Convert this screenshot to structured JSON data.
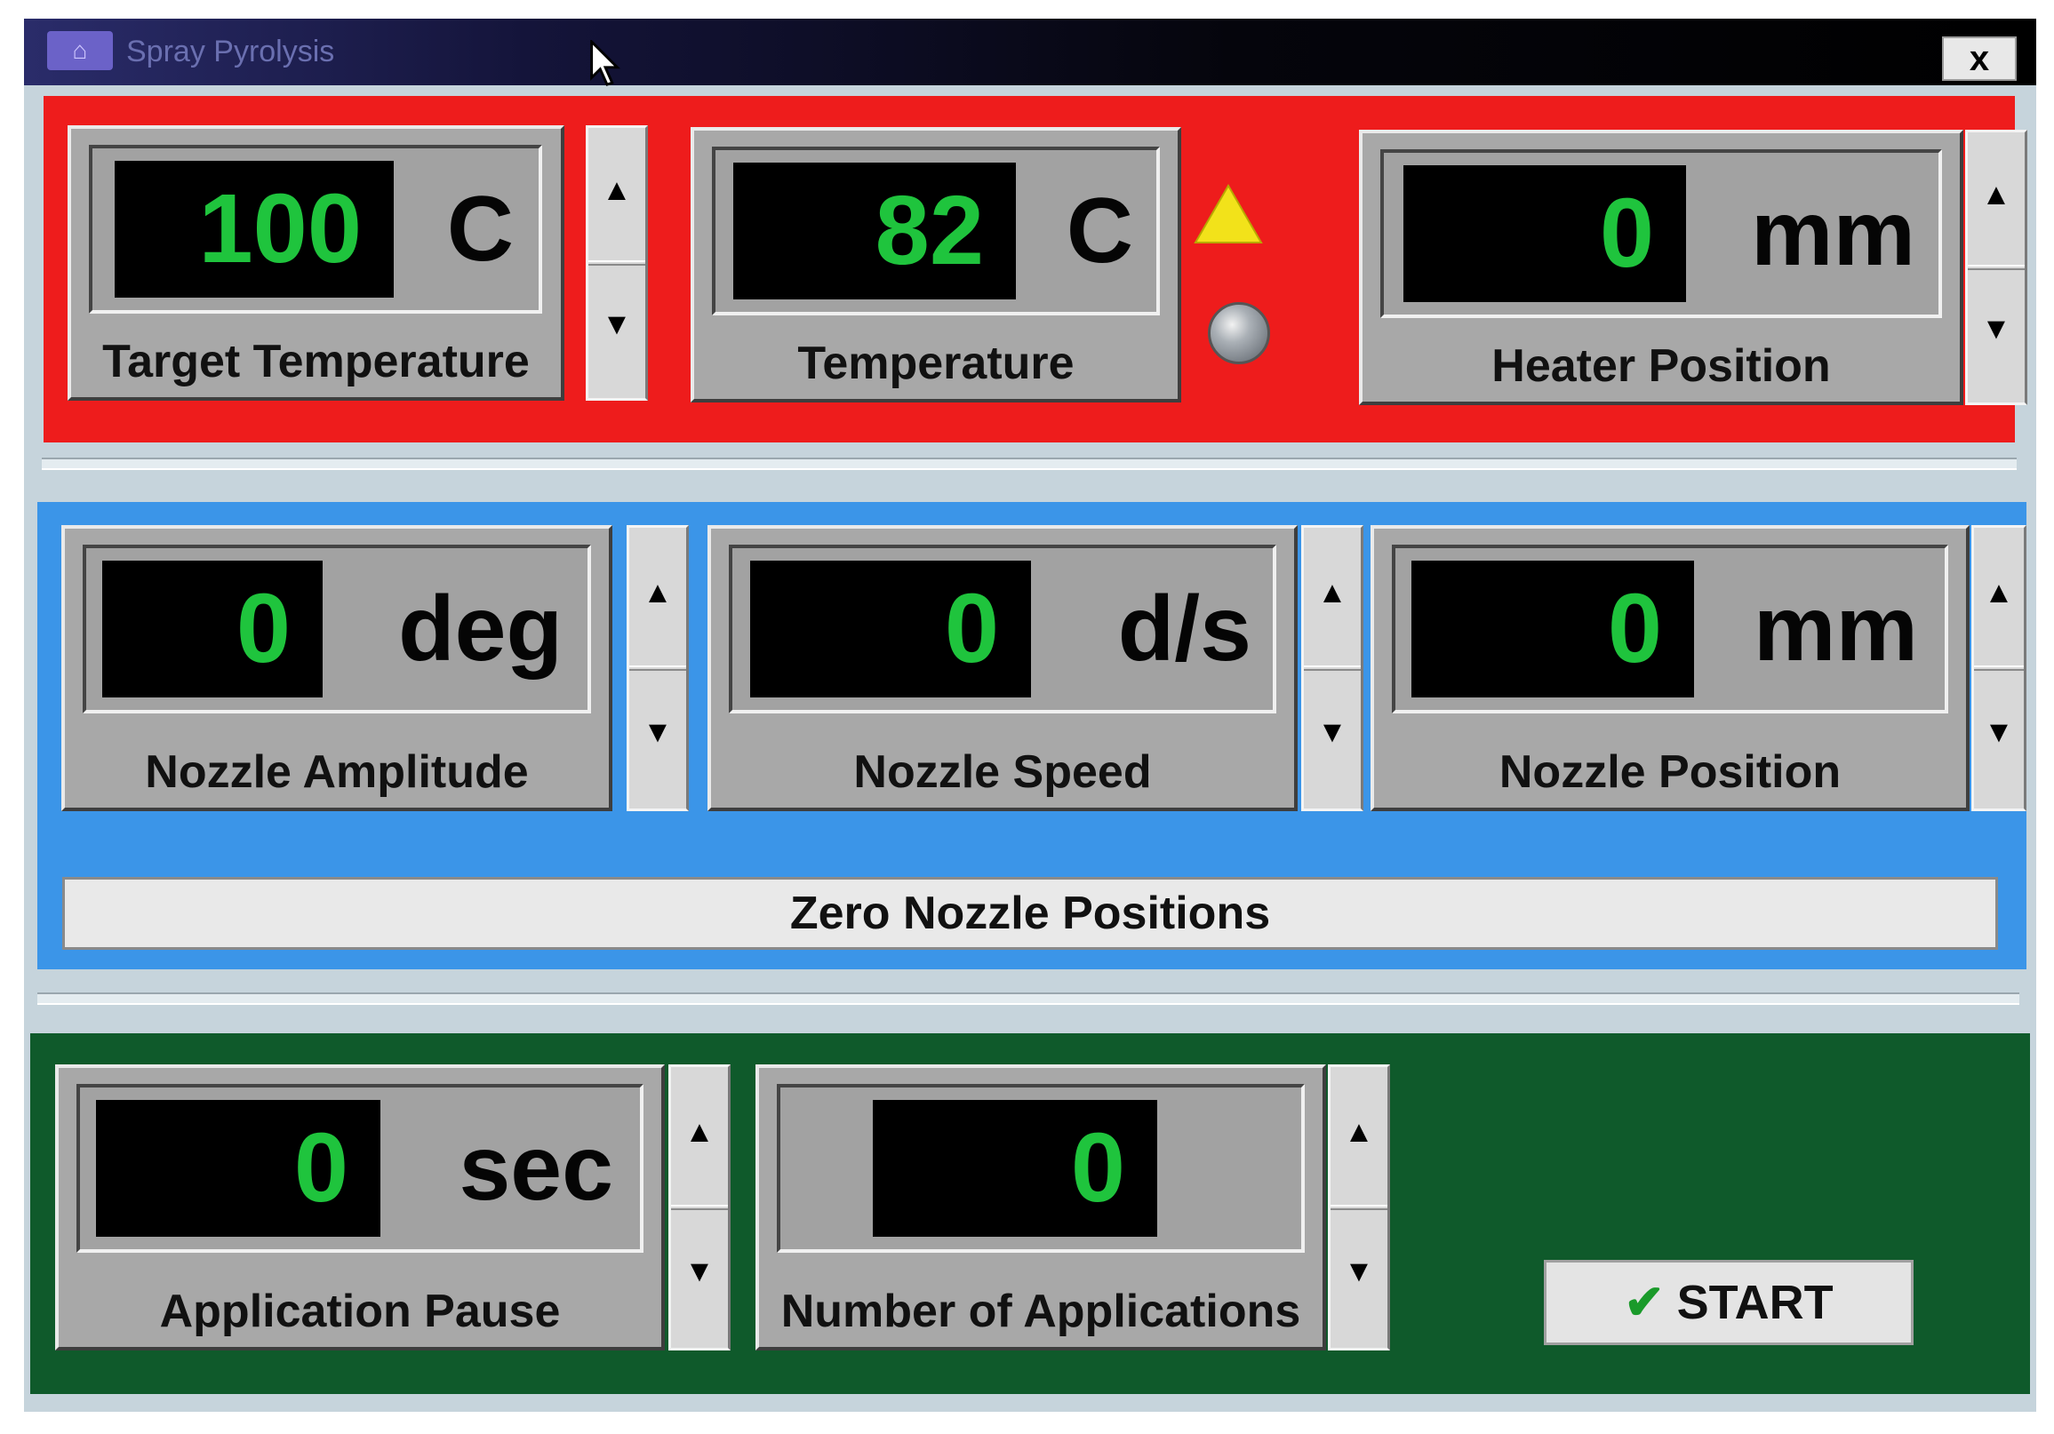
{
  "window": {
    "title": "Spray Pyrolysis",
    "close_label": "x"
  },
  "heater_panel": {
    "target_temperature": {
      "value": "100",
      "unit": "C",
      "label": "Target Temperature"
    },
    "temperature": {
      "value": "82",
      "unit": "C",
      "label": "Temperature"
    },
    "heater_position": {
      "value": "0",
      "unit": "mm",
      "label": "Heater Position"
    },
    "indicators": {
      "warning_color": "#f2e21a",
      "status_led_color": "#9aa0a8"
    }
  },
  "nozzle_panel": {
    "amplitude": {
      "value": "0",
      "unit": "deg",
      "label": "Nozzle Amplitude"
    },
    "speed": {
      "value": "0",
      "unit": "d/s",
      "label": "Nozzle Speed"
    },
    "position": {
      "value": "0",
      "unit": "mm",
      "label": "Nozzle Position"
    },
    "zero_button": "Zero Nozzle Positions"
  },
  "application_panel": {
    "pause": {
      "value": "0",
      "unit": "sec",
      "label": "Application Pause"
    },
    "count": {
      "value": "0",
      "label": "Number of Applications"
    },
    "start_button": "START"
  },
  "spinner": {
    "up": "▲",
    "down": "▼"
  },
  "colors": {
    "heater_panel": "#ee1c1c",
    "nozzle_panel": "#3b95e8",
    "application_panel": "#0f5a2b",
    "display_digits": "#1fc43d"
  }
}
